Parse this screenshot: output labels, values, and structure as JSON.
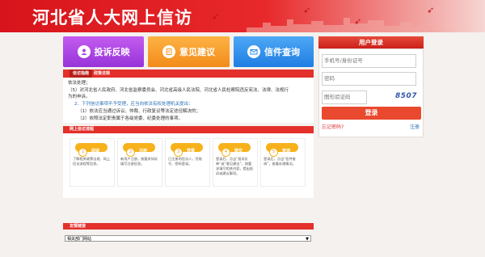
{
  "header": {
    "title": "河北省人大网上信访"
  },
  "tiles": [
    {
      "label": "投诉反映",
      "icon": "document-user-icon",
      "color": "#a946e3"
    },
    {
      "label": "意见建议",
      "icon": "clipboard-pen-icon",
      "color": "#f59a24"
    },
    {
      "label": "信件查询",
      "icon": "mail-search-icon",
      "color": "#2b8ae8"
    }
  ],
  "tabs": {
    "active": "信访指南",
    "other": "政策法规"
  },
  "news": {
    "line0": "依法处理；",
    "line1": "（5）对河北省人民政府、河北省监察委员会、河北省高级人民法院、河北省人民检察院违反宪法、法律、法规行",
    "line2": "为的申诉。",
    "line3": "2．下列信访事项不予受理，应当向依法有权处理机关提出：",
    "line4": "（1）依法应当通过诉讼、仲裁、行政复议等法定途径解决的；",
    "line5": "（2）依照法定职责属于各级党委、纪委处理的事项。"
  },
  "flow": {
    "title": "网上信访流程",
    "steps": [
      {
        "num": "1",
        "label": "阅读",
        "desc": "了解相关政策法规、网上信访流程等信息。"
      },
      {
        "num": "2",
        "label": "注册",
        "desc": "新用户注册，按要求如实填写注册信息。"
      },
      {
        "num": "3",
        "label": "登录",
        "desc": "已注册的信访人，凭账号、密码登录。"
      },
      {
        "num": "4",
        "label": "提交",
        "desc": "登录后，点击“投诉反映”或“意见建议”，按要求填写相关内容，提出投诉或建议事项。"
      },
      {
        "num": "5",
        "label": "查询",
        "desc": "登录后，点击“信件查询”，查看办理情况。"
      }
    ]
  },
  "links": {
    "title": "友情链接",
    "select_value": "相关部门网站"
  },
  "login": {
    "title": "用户登录",
    "account_placeholder": "手机号/身份证号",
    "password_placeholder": "密码",
    "captcha_placeholder": "图形验证码",
    "captcha_text": "8507",
    "login_label": "登录",
    "forgot_label": "忘记密码?",
    "register_label": "注册"
  },
  "colors": {
    "brand_red": "#d7141b",
    "accent_orange": "#e8492f",
    "step_yellow": "#f7b21b"
  }
}
